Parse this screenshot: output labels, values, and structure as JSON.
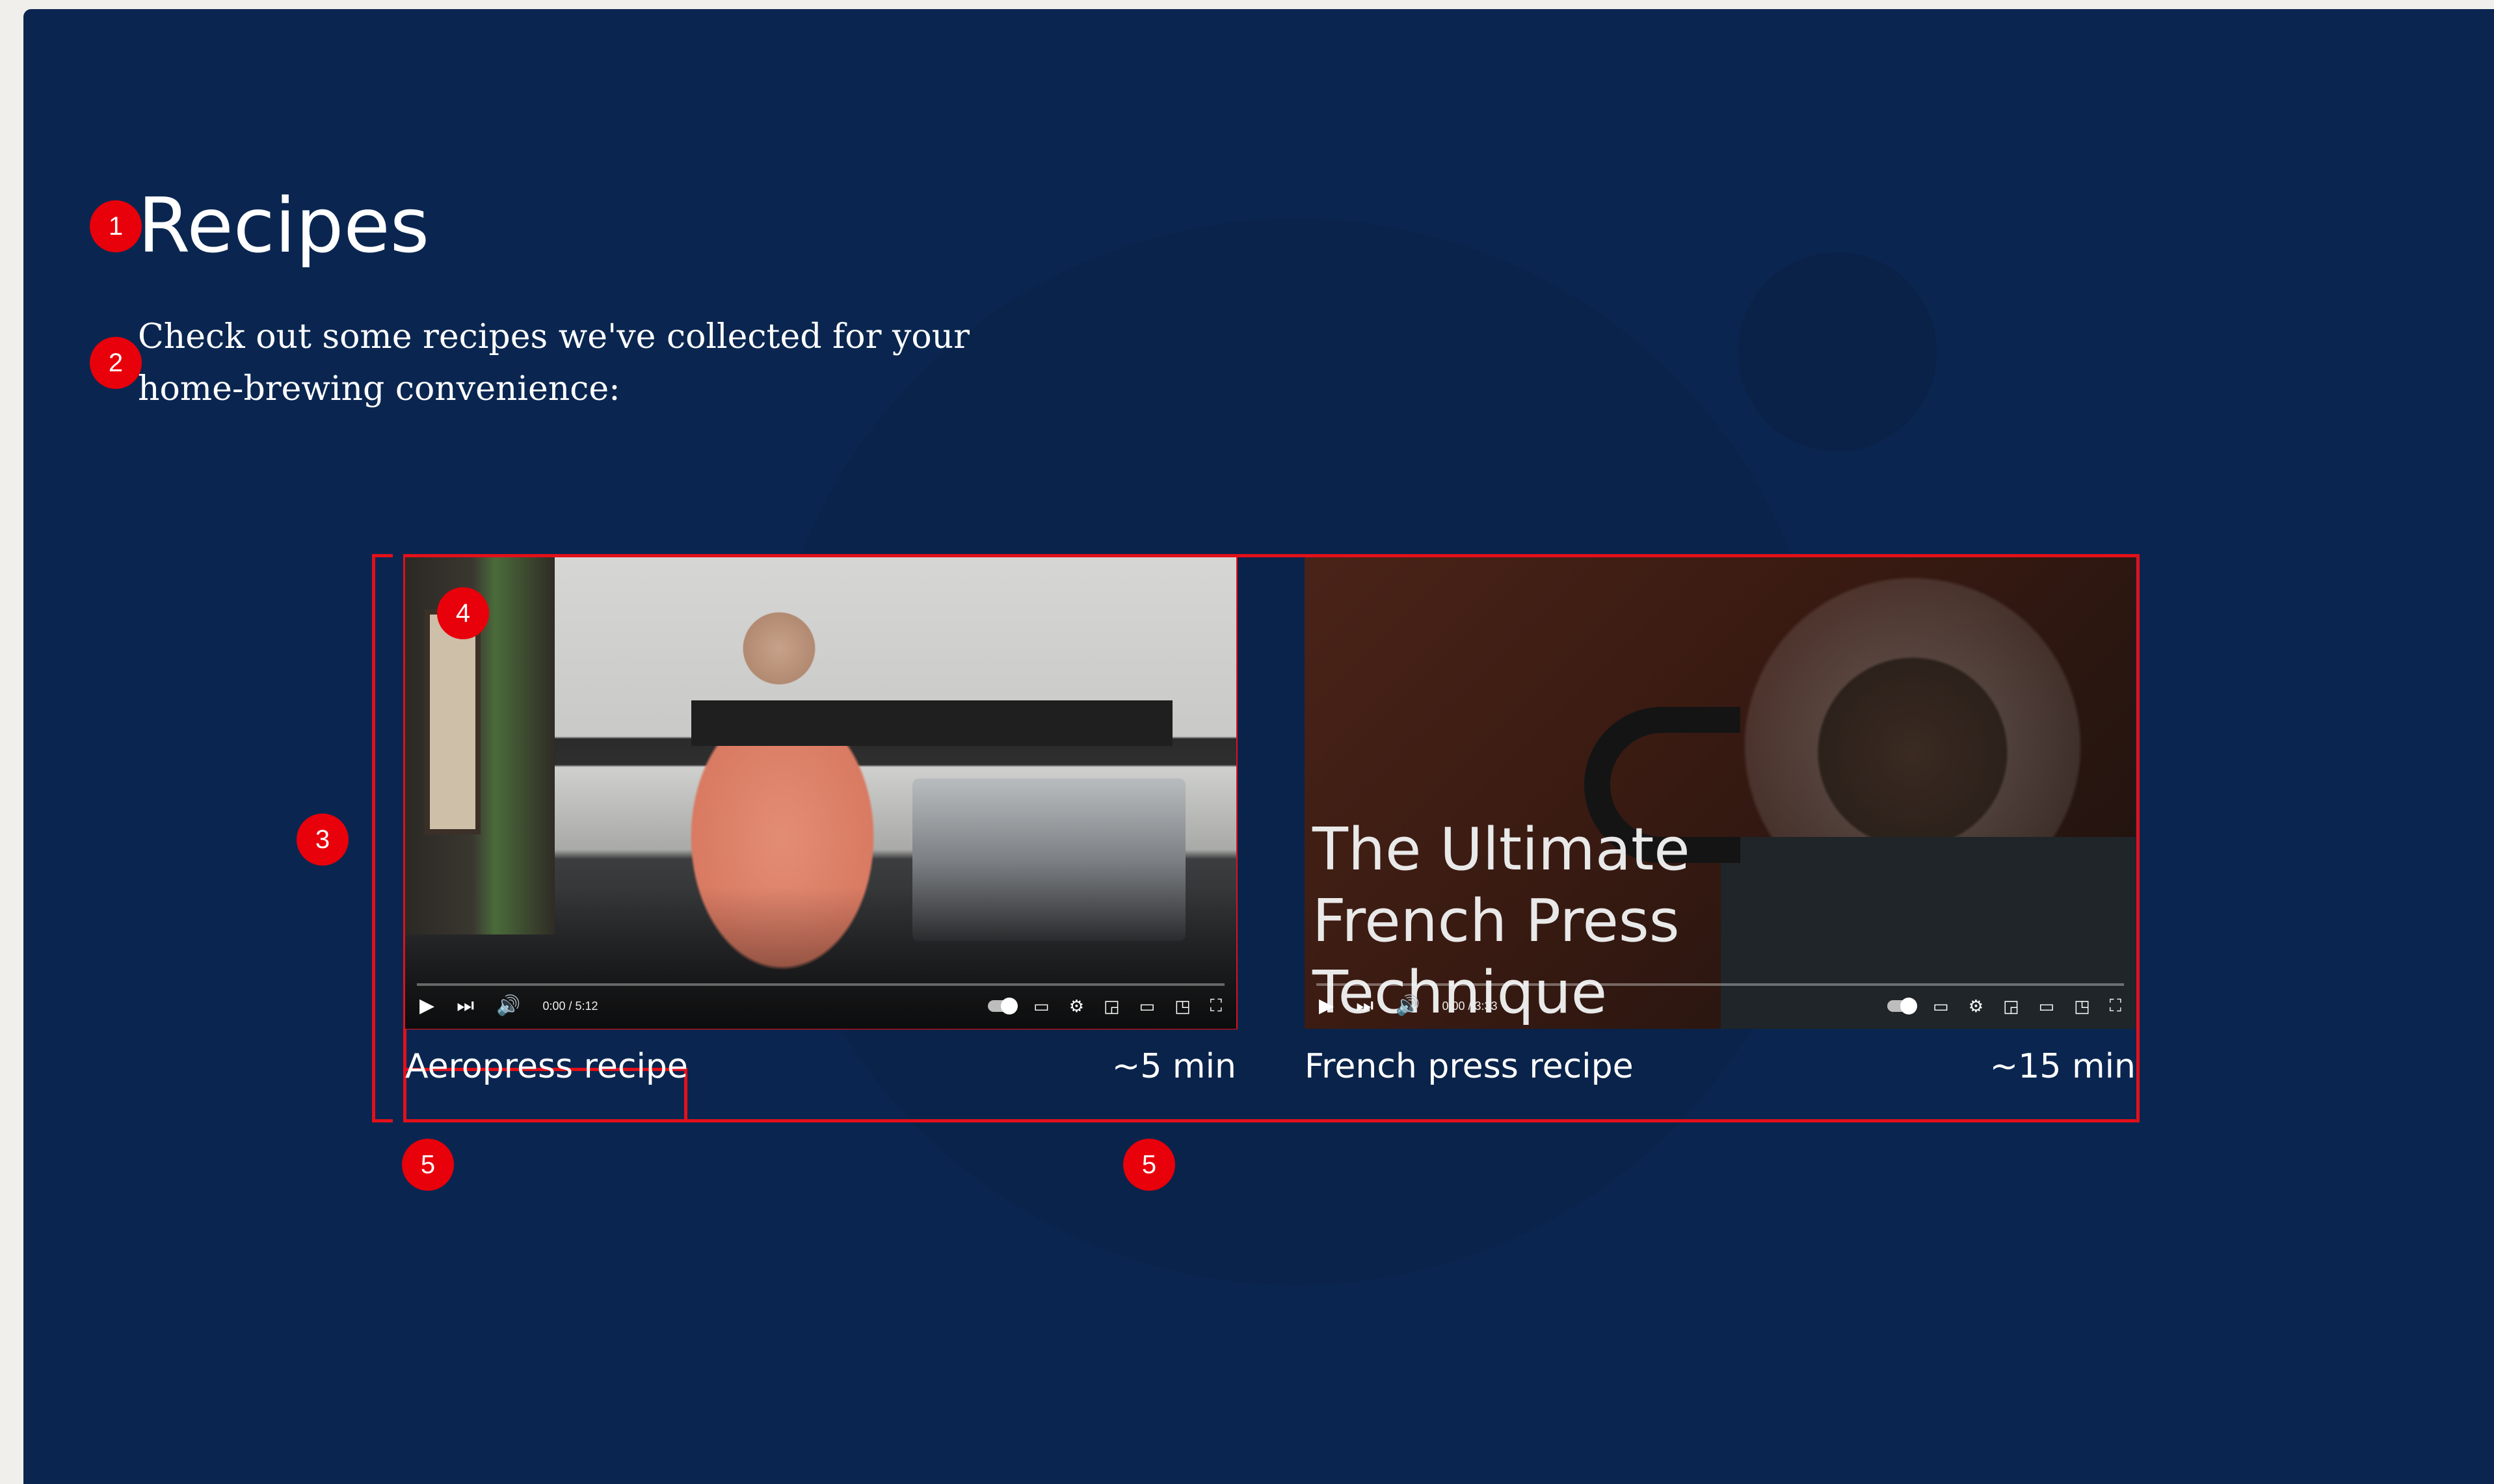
{
  "page": {
    "title": "Recipes",
    "intro": "Check out some recipes we've collected for your home-brewing convenience:"
  },
  "annotations": {
    "badge_1": "1",
    "badge_2": "2",
    "badge_3": "3",
    "badge_4": "4",
    "badge_5a": "5",
    "badge_5b": "5"
  },
  "recipes": [
    {
      "name": "Aeropress recipe",
      "duration": "~5 min",
      "video": {
        "time": "0:00 / 5:12",
        "overlay_title": ""
      }
    },
    {
      "name": "French press recipe",
      "duration": "~15 min",
      "video": {
        "time": "0:00 / 3:33",
        "overlay_title": "The Ultimate\nFrench Press\nTechnique"
      }
    }
  ],
  "player_icons": {
    "play": "play-icon",
    "next": "next-icon",
    "volume": "volume-icon",
    "autoplay": "autoplay-toggle-icon",
    "subtitles": "subtitles-icon",
    "settings": "gear-icon",
    "miniplayer": "miniplayer-icon",
    "theater": "theater-mode-icon",
    "cast": "cast-icon",
    "fullscreen": "fullscreen-icon"
  },
  "colors": {
    "background": "#0a2650",
    "annotation_red": "#e8000b",
    "text": "#ffffff"
  }
}
